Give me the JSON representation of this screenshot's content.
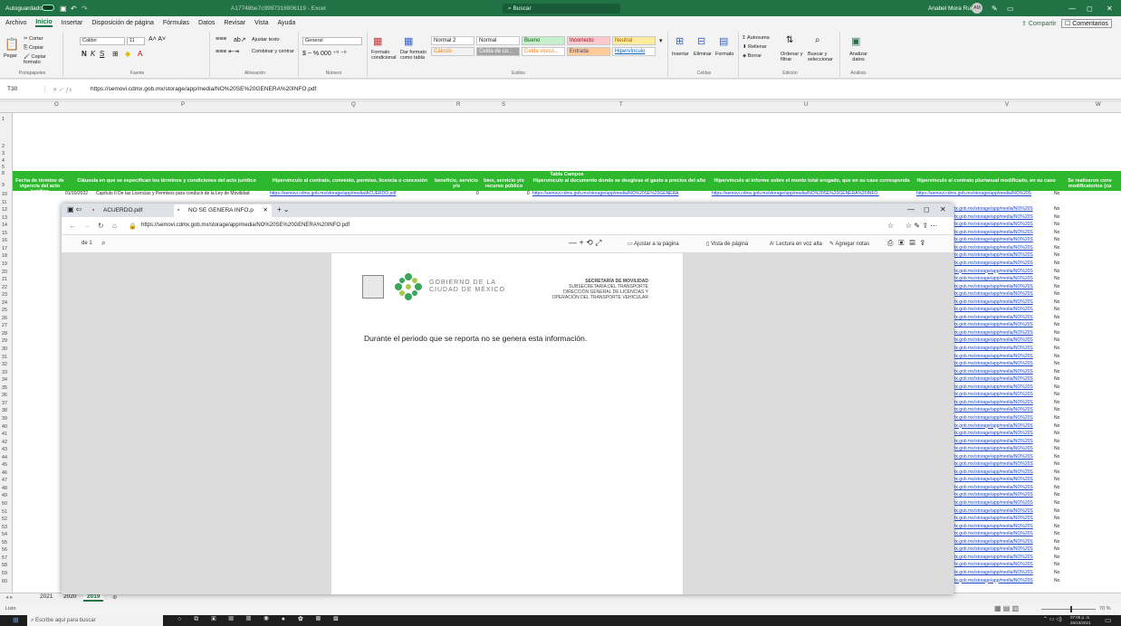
{
  "excel": {
    "autosave": "Autoguardado",
    "title": "A17748be7c9997316906119 - Excel",
    "search": "Buscar",
    "user": "Anabel Mora Ruiz",
    "user_initials": "AM",
    "tabs": [
      "Archivo",
      "Inicio",
      "Insertar",
      "Disposición de página",
      "Fórmulas",
      "Datos",
      "Revisar",
      "Vista",
      "Ayuda"
    ],
    "share": "Compartir",
    "comments": "Comentarios",
    "clipboard": {
      "cut": "Cortar",
      "copy": "Copiar",
      "paste": "Pegar",
      "format": "Copiar formato",
      "label": "Portapapeles"
    },
    "font": {
      "name": "Calibri",
      "size": "11",
      "label": "Fuente"
    },
    "alignment": {
      "wrap": "Ajustar texto",
      "merge": "Combinar y centrar",
      "label": "Alineación"
    },
    "number": {
      "format": "General",
      "label": "Número"
    },
    "styles": {
      "cond": "Formato condicional",
      "table": "Dar formato como tabla",
      "normal2": "Normal 2",
      "normal": "Normal",
      "bueno": "Bueno",
      "incorrecto": "Incorrecto",
      "neutral": "Neutral",
      "calculo": "Cálculo",
      "celda_co": "Celda de co...",
      "celda_vin": "Celda vincul...",
      "entrada": "Entrada",
      "hipervinculo": "Hipervínculo",
      "label": "Estilos"
    },
    "cells": {
      "insert": "Insertar",
      "delete": "Eliminar",
      "format": "Formato",
      "label": "Celdas"
    },
    "editing": {
      "autosum": "Autosuma",
      "fill": "Rellenar",
      "clear": "Borrar",
      "sort": "Ordenar y filtrar",
      "find": "Buscar y seleccionar",
      "label": "Edición"
    },
    "analysis": {
      "btn": "Analizar datos",
      "label": "Análisis"
    },
    "cell_ref": "T30",
    "formula": "https://semovi.cdmx.gob.mx/storage/app/media/NO%20SE%20GENERA%20INFO.pdf",
    "columns": [
      "O",
      "P",
      "Q",
      "R",
      "S",
      "T",
      "U",
      "V",
      "W"
    ],
    "table_title": "Tabla Campos",
    "headers": [
      "Fecha de término de vigencia del acto jurídico",
      "Cláusula en que se especifican los términos y condiciones del acto jurídico",
      "Hipervínculo al contrato, convenio, permiso, licencia o concesión",
      "beneficio, servicio y/o",
      "bien, servicio y/o recurso público",
      "Hipervínculo al documento donde se desglose el gasto a precios del año",
      "Hipervínculo al informe sobre el monto total erogado, que en su caso corresponda",
      "Hipervínculo al contrato plurianual modificado, en su caso",
      "Se realizaron conv modificatorios (ca"
    ],
    "row10": {
      "date": "01/10/2022",
      "clause": "Capítulo II De las Licencias y Permisos para conducir de la Ley de Movilidad",
      "link1": "https://semovi.cdmx.gob.mx/storage/app/media/ACUERDO.pdf",
      "zero": "0",
      "zero2": "0",
      "link2": "https://semovi.cdmx.gob.mx/storage/app/media/NO%20SE%20GENERA",
      "link3": "https://semovi.cdmx.gob.mx/storage/app/media/NO%20SE%20GENERA%20INFO.",
      "link4": "https://semovi.cdmx.gob.mx/storage/app/media/NO%20S",
      "no": "No"
    },
    "side_link": "tx.gob.mx/storage/app/media/NO%20S",
    "side_no": "No",
    "sheet_tabs": [
      "2021",
      "2020",
      "2019"
    ],
    "status_left": "Listo",
    "zoom": "70 %"
  },
  "browser": {
    "tabs": [
      {
        "label": "ACUERDO.pdf"
      },
      {
        "label": "NO SE GENERA INFO.p"
      }
    ],
    "url": "https://semovi.cdmx.gob.mx/storage/app/media/NO%20SE%20GENERA%20INFO.pdf",
    "page_of": "de 1",
    "fit": "Ajustar a la página",
    "page_view": "Vista de página",
    "read": "Lectura en voz alta",
    "notes": "Agregar notas"
  },
  "pdf": {
    "gov1": "GOBIERNO DE LA",
    "gov2": "CIUDAD DE MÉXICO",
    "sec": "SECRETARÍA DE MOVILIDAD",
    "sub": "SUBSECRETARÍA DEL TRANSPORTE",
    "dir1": "DIRECCIÓN GENERAL DE LICENCIAS Y",
    "dir2": "OPERACIÓN DEL TRANSPORTE VEHICULAR",
    "body": "Durante el periodo que se reporta no se genera esta información."
  },
  "taskbar": {
    "search": "Escribe aquí para buscar",
    "time": "07:05 p. m.",
    "date": "26/10/2021"
  }
}
